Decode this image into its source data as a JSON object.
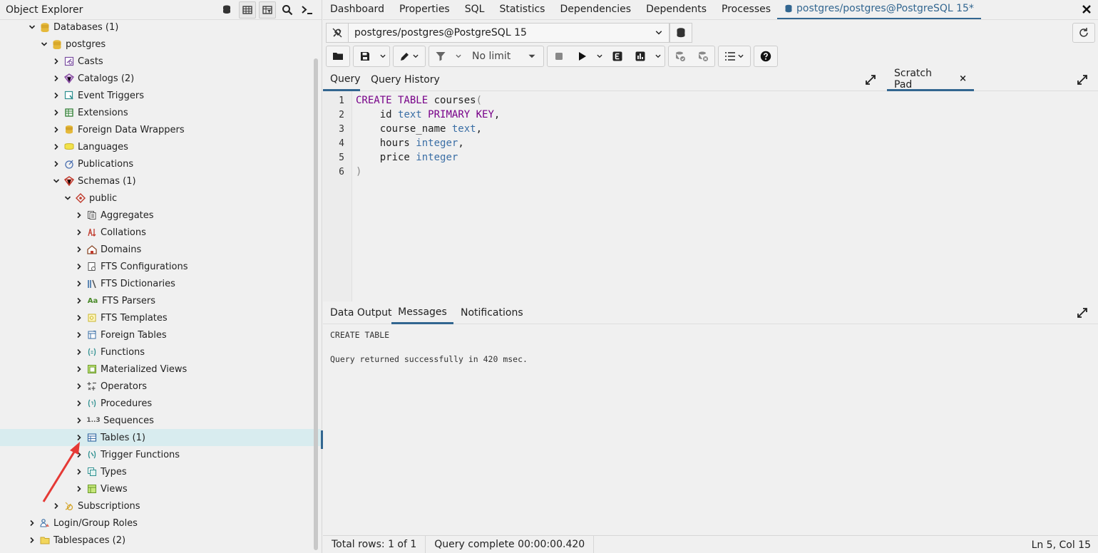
{
  "object_explorer": {
    "title": "Object Explorer",
    "tree": [
      {
        "label": "Databases (1)",
        "expanded": true,
        "icon": "database-icon"
      },
      {
        "label": "postgres",
        "expanded": true,
        "icon": "database-icon"
      },
      {
        "label": "Casts",
        "icon": "casts-icon"
      },
      {
        "label": "Catalogs (2)",
        "icon": "catalogs-icon"
      },
      {
        "label": "Event Triggers",
        "icon": "event-triggers-icon"
      },
      {
        "label": "Extensions",
        "icon": "extensions-icon"
      },
      {
        "label": "Foreign Data Wrappers",
        "icon": "foreign-data-wrappers-icon"
      },
      {
        "label": "Languages",
        "icon": "languages-icon"
      },
      {
        "label": "Publications",
        "icon": "publications-icon"
      },
      {
        "label": "Schemas (1)",
        "expanded": true,
        "icon": "schemas-icon"
      },
      {
        "label": "public",
        "expanded": true,
        "icon": "schema-icon"
      },
      {
        "label": "Aggregates",
        "icon": "aggregates-icon"
      },
      {
        "label": "Collations",
        "icon": "collations-icon"
      },
      {
        "label": "Domains",
        "icon": "domains-icon"
      },
      {
        "label": "FTS Configurations",
        "icon": "fts-configurations-icon"
      },
      {
        "label": "FTS Dictionaries",
        "icon": "fts-dictionaries-icon"
      },
      {
        "label": "FTS Parsers",
        "icon": "fts-parsers-icon",
        "glyph": "Aa"
      },
      {
        "label": "FTS Templates",
        "icon": "fts-templates-icon"
      },
      {
        "label": "Foreign Tables",
        "icon": "foreign-tables-icon"
      },
      {
        "label": "Functions",
        "icon": "functions-icon"
      },
      {
        "label": "Materialized Views",
        "icon": "materialized-views-icon"
      },
      {
        "label": "Operators",
        "icon": "operators-icon"
      },
      {
        "label": "Procedures",
        "icon": "procedures-icon"
      },
      {
        "label": "Sequences",
        "icon": "sequences-icon",
        "glyph": "1..3"
      },
      {
        "label": "Tables (1)",
        "icon": "tables-icon",
        "selected": true
      },
      {
        "label": "Trigger Functions",
        "icon": "trigger-functions-icon"
      },
      {
        "label": "Types",
        "icon": "types-icon"
      },
      {
        "label": "Views",
        "icon": "views-icon"
      },
      {
        "label": "Subscriptions",
        "icon": "subscriptions-icon"
      },
      {
        "label": "Login/Group Roles",
        "icon": "login-roles-icon"
      },
      {
        "label": "Tablespaces (2)",
        "icon": "tablespaces-icon"
      }
    ]
  },
  "top_tabs": [
    "Dashboard",
    "Properties",
    "SQL",
    "Statistics",
    "Dependencies",
    "Dependents",
    "Processes"
  ],
  "active_tab": "postgres/postgres@PostgreSQL 15*",
  "connection": "postgres/postgres@PostgreSQL 15",
  "toolbar": {
    "limit": "No limit"
  },
  "query_tabs": {
    "query": "Query",
    "history": "Query History",
    "scratch": "Scratch Pad",
    "scratch_close": "×"
  },
  "editor": {
    "line_numbers": [
      "1",
      "2",
      "3",
      "4",
      "5",
      "6"
    ]
  },
  "result_tabs": {
    "data_output": "Data Output",
    "messages": "Messages",
    "notifications": "Notifications"
  },
  "messages": {
    "line1": "CREATE TABLE",
    "line2": "Query returned successfully in 420 msec."
  },
  "status": {
    "rows": "Total rows: 1 of 1",
    "complete": "Query complete 00:00:00.420",
    "position": "Ln 5, Col 15"
  },
  "colors": {
    "accent": "#326690",
    "keyword": "#770088",
    "type": "#3a6ea5",
    "selected_row": "#d8ecef",
    "annotation_arrow": "#e53935"
  }
}
